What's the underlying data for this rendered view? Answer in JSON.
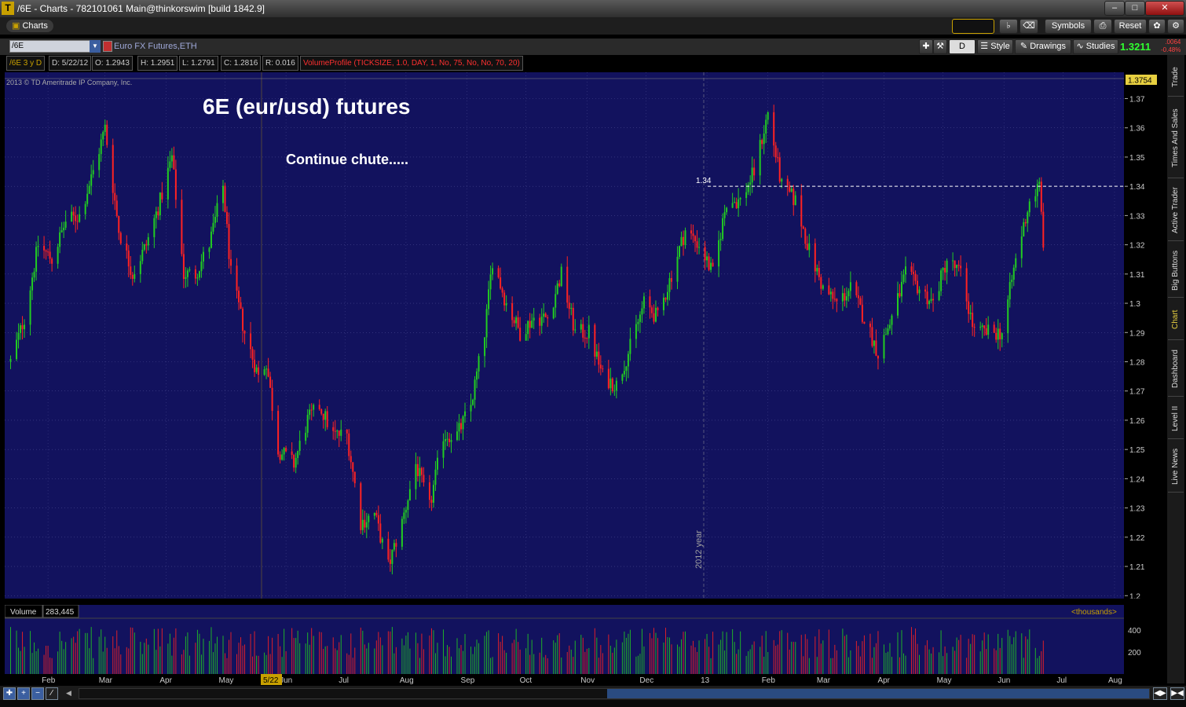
{
  "window": {
    "title": "/6E - Charts - 782101061 Main@thinkorswim [build 1842.9]",
    "logo": "T",
    "buttons": [
      "–",
      "□",
      "✕"
    ]
  },
  "toolbar": {
    "charts_tab": "Charts",
    "symbols": "Symbols",
    "reset": "Reset"
  },
  "symbolbar": {
    "symbol": "/6E",
    "description": "Euro FX Futures,ETH",
    "period": "D",
    "style": "Style",
    "drawings": "Drawings",
    "studies": "Studies",
    "last_price": "1.3211",
    "net_change": ".0064",
    "pct_change": "-0.48%"
  },
  "infobar": {
    "period_label": "/6E 3 y D",
    "date": "D: 5/22/12",
    "open": "O: 1.2943",
    "high": "H: 1.2951",
    "low": "L: 1.2791",
    "close": "C: 1.2816",
    "range": "R: 0.016",
    "study": "VolumeProfile (TICKSIZE, 1.0, DAY, 1, No, 75, No, No, 70, 20)"
  },
  "chart": {
    "copyright": "2013 © TD Ameritrade IP Company, Inc.",
    "annotation_title": "6E (eur/usd) futures",
    "annotation_note": "Continue chute.....",
    "hline_label": "1.34",
    "year_marker": "2012 year",
    "price_high_badge": "1.3754",
    "volume_label": "Volume",
    "volume_value": "283,445",
    "volume_units": "<thousands>",
    "cursor_date": "5/22",
    "colors": {
      "up": "#22cc22",
      "down": "#ff2222",
      "background": "#12125e"
    }
  },
  "right_tabs": [
    "Trade",
    "Times And Sales",
    "Active Trader",
    "Big Buttons",
    "Chart",
    "Dashboard",
    "Level II",
    "Live News"
  ],
  "chart_data": {
    "type": "candlestick",
    "price_ticks": [
      "1.37",
      "1.36",
      "1.35",
      "1.34",
      "1.33",
      "1.32",
      "1.31",
      "1.3",
      "1.29",
      "1.28",
      "1.27",
      "1.26",
      "1.25",
      "1.24",
      "1.23",
      "1.22",
      "1.21",
      "1.2"
    ],
    "price_range": [
      1.199,
      1.379
    ],
    "volume_ticks": [
      "400",
      "200"
    ],
    "months": [
      "Feb",
      "Mar",
      "Apr",
      "May",
      "Jun",
      "Jul",
      "Aug",
      "Sep",
      "Oct",
      "Nov",
      "Dec",
      "13",
      "Feb",
      "Mar",
      "Apr",
      "May",
      "Jun",
      "Jul",
      "Aug"
    ],
    "reference_line": 1.34,
    "close_path": [
      {
        "date": "2012-01-13",
        "close": 1.28
      },
      {
        "date": "2012-01-20",
        "close": 1.295
      },
      {
        "date": "2012-01-27",
        "close": 1.32
      },
      {
        "date": "2012-02-03",
        "close": 1.315
      },
      {
        "date": "2012-02-10",
        "close": 1.328
      },
      {
        "date": "2012-02-17",
        "close": 1.33
      },
      {
        "date": "2012-02-24",
        "close": 1.345
      },
      {
        "date": "2012-03-01",
        "close": 1.36
      },
      {
        "date": "2012-03-08",
        "close": 1.325
      },
      {
        "date": "2012-03-15",
        "close": 1.31
      },
      {
        "date": "2012-03-22",
        "close": 1.32
      },
      {
        "date": "2012-03-29",
        "close": 1.335
      },
      {
        "date": "2012-04-04",
        "close": 1.35
      },
      {
        "date": "2012-04-10",
        "close": 1.31
      },
      {
        "date": "2012-04-16",
        "close": 1.31
      },
      {
        "date": "2012-04-23",
        "close": 1.32
      },
      {
        "date": "2012-04-30",
        "close": 1.34
      },
      {
        "date": "2012-05-04",
        "close": 1.31
      },
      {
        "date": "2012-05-11",
        "close": 1.29
      },
      {
        "date": "2012-05-18",
        "close": 1.275
      },
      {
        "date": "2012-05-22",
        "close": 1.28
      },
      {
        "date": "2012-05-28",
        "close": 1.25
      },
      {
        "date": "2012-06-05",
        "close": 1.245
      },
      {
        "date": "2012-06-12",
        "close": 1.26
      },
      {
        "date": "2012-06-18",
        "close": 1.265
      },
      {
        "date": "2012-06-25",
        "close": 1.255
      },
      {
        "date": "2012-07-02",
        "close": 1.255
      },
      {
        "date": "2012-07-09",
        "close": 1.225
      },
      {
        "date": "2012-07-16",
        "close": 1.228
      },
      {
        "date": "2012-07-23",
        "close": 1.21
      },
      {
        "date": "2012-07-30",
        "close": 1.225
      },
      {
        "date": "2012-08-06",
        "close": 1.245
      },
      {
        "date": "2012-08-13",
        "close": 1.23
      },
      {
        "date": "2012-08-20",
        "close": 1.255
      },
      {
        "date": "2012-08-27",
        "close": 1.255
      },
      {
        "date": "2012-09-03",
        "close": 1.265
      },
      {
        "date": "2012-09-10",
        "close": 1.29
      },
      {
        "date": "2012-09-14",
        "close": 1.315
      },
      {
        "date": "2012-09-21",
        "close": 1.3
      },
      {
        "date": "2012-09-28",
        "close": 1.29
      },
      {
        "date": "2012-10-05",
        "close": 1.295
      },
      {
        "date": "2012-10-12",
        "close": 1.295
      },
      {
        "date": "2012-10-19",
        "close": 1.31
      },
      {
        "date": "2012-10-26",
        "close": 1.29
      },
      {
        "date": "2012-11-02",
        "close": 1.29
      },
      {
        "date": "2012-11-09",
        "close": 1.275
      },
      {
        "date": "2012-11-16",
        "close": 1.272
      },
      {
        "date": "2012-11-23",
        "close": 1.285
      },
      {
        "date": "2012-11-30",
        "close": 1.3
      },
      {
        "date": "2012-12-07",
        "close": 1.295
      },
      {
        "date": "2012-12-14",
        "close": 1.31
      },
      {
        "date": "2012-12-21",
        "close": 1.325
      },
      {
        "date": "2012-12-28",
        "close": 1.32
      },
      {
        "date": "2013-01-04",
        "close": 1.31
      },
      {
        "date": "2013-01-11",
        "close": 1.335
      },
      {
        "date": "2013-01-18",
        "close": 1.335
      },
      {
        "date": "2013-01-25",
        "close": 1.345
      },
      {
        "date": "2013-02-01",
        "close": 1.365
      },
      {
        "date": "2013-02-08",
        "close": 1.34
      },
      {
        "date": "2013-02-15",
        "close": 1.335
      },
      {
        "date": "2013-02-22",
        "close": 1.318
      },
      {
        "date": "2013-03-01",
        "close": 1.305
      },
      {
        "date": "2013-03-08",
        "close": 1.3
      },
      {
        "date": "2013-03-15",
        "close": 1.305
      },
      {
        "date": "2013-03-22",
        "close": 1.295
      },
      {
        "date": "2013-03-29",
        "close": 1.283
      },
      {
        "date": "2013-04-05",
        "close": 1.295
      },
      {
        "date": "2013-04-12",
        "close": 1.31
      },
      {
        "date": "2013-04-19",
        "close": 1.305
      },
      {
        "date": "2013-04-26",
        "close": 1.3
      },
      {
        "date": "2013-05-03",
        "close": 1.315
      },
      {
        "date": "2013-05-10",
        "close": 1.31
      },
      {
        "date": "2013-05-17",
        "close": 1.29
      },
      {
        "date": "2013-05-24",
        "close": 1.29
      },
      {
        "date": "2013-05-31",
        "close": 1.29
      },
      {
        "date": "2013-06-07",
        "close": 1.315
      },
      {
        "date": "2013-06-14",
        "close": 1.335
      },
      {
        "date": "2013-06-19",
        "close": 1.34
      },
      {
        "date": "2013-06-21",
        "close": 1.321
      }
    ]
  }
}
